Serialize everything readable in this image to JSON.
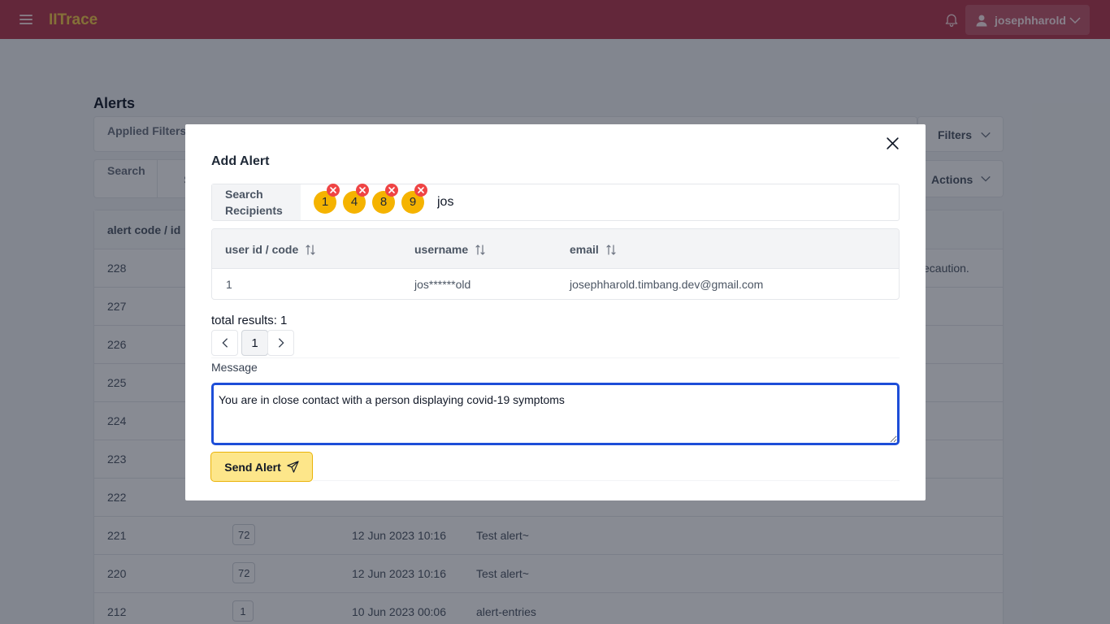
{
  "header": {
    "brand": "IITrace",
    "username": "josephharold"
  },
  "page": {
    "title": "Alerts",
    "applied_filters_label": "Applied Filters",
    "search_label": "Search",
    "search_partial": "S",
    "filters_button": "Filters",
    "actions_button": "Actions",
    "table": {
      "header_first": "alert code / id",
      "rows": [
        {
          "code": "228",
          "user": "",
          "date": "",
          "message": "",
          "tail": "ecaution."
        },
        {
          "code": "227",
          "user": "",
          "date": "",
          "message": "",
          "tail": ""
        },
        {
          "code": "226",
          "user": "",
          "date": "",
          "message": "",
          "tail": ""
        },
        {
          "code": "225",
          "user": "",
          "date": "",
          "message": "",
          "tail": ""
        },
        {
          "code": "224",
          "user": "",
          "date": "",
          "message": "",
          "tail": ""
        },
        {
          "code": "223",
          "user": "",
          "date": "",
          "message": "",
          "tail": ""
        },
        {
          "code": "222",
          "user": "",
          "date": "",
          "message": "",
          "tail": ""
        },
        {
          "code": "221",
          "user": "72",
          "date": "12 Jun 2023 10:16",
          "message": "Test alert~",
          "tail": ""
        },
        {
          "code": "220",
          "user": "72",
          "date": "12 Jun 2023 10:16",
          "message": "Test alert~",
          "tail": ""
        },
        {
          "code": "212",
          "user": "1",
          "date": "10 Jun 2023 00:06",
          "message": "alert-entries",
          "tail": ""
        }
      ]
    }
  },
  "modal": {
    "title": "Add Alert",
    "recipients_label": "Search Recipients",
    "chips": [
      "1",
      "4",
      "8",
      "9"
    ],
    "search_value": "jos",
    "columns": [
      "user id / code",
      "username",
      "email"
    ],
    "results": [
      {
        "id": "1",
        "username": "jos******old",
        "email": "josephharold.timbang.dev@gmail.com"
      }
    ],
    "total_results": "total results: 1",
    "current_page": "1",
    "message_label": "Message",
    "message_value": "You are in close contact with a person displaying covid-19 symptoms",
    "send_label": "Send Alert"
  },
  "colors": {
    "topbar": "#b4364c",
    "brand": "#f7c948",
    "chip": "#f5b300",
    "chip_remove": "#ef4444",
    "send_button": "#fde68a",
    "focus_ring": "#1d4ed8"
  },
  "icons": [
    "menu-icon",
    "bell-icon",
    "user-icon",
    "chevron-down-icon",
    "close-icon",
    "remove-chip-icon",
    "sort-icon",
    "chevron-left-icon",
    "chevron-right-icon",
    "send-icon"
  ]
}
